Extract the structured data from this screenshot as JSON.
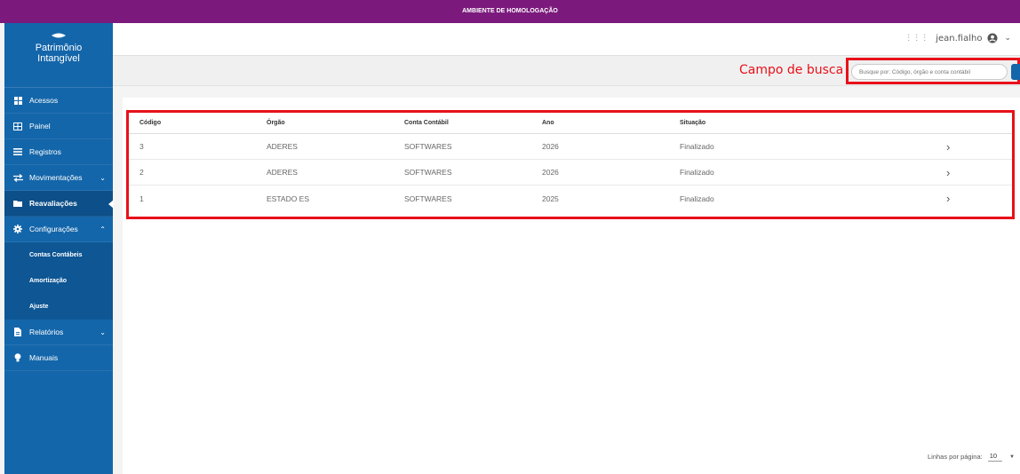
{
  "env_banner": "AMBIENTE DE HOMOLOGAÇÃO",
  "colors": {
    "env": "#7b1a7c",
    "sidebar": "#1466aa",
    "highlight": "#e8101a"
  },
  "logo": {
    "line1": "Patrimônio",
    "line2": "Intangível"
  },
  "sidebar": {
    "items": [
      {
        "label": "Acessos",
        "icon": "grid-icon"
      },
      {
        "label": "Painel",
        "icon": "dashboard-icon"
      },
      {
        "label": "Registros",
        "icon": "list-icon"
      },
      {
        "label": "Movimentações",
        "icon": "swap-icon"
      },
      {
        "label": "Reavaliações",
        "icon": "folder-icon"
      },
      {
        "label": "Configurações",
        "icon": "gear-icon"
      }
    ],
    "subitems": [
      {
        "label": "Contas Contábeis"
      },
      {
        "label": "Amortização"
      },
      {
        "label": "Ajuste"
      }
    ],
    "bottom_items": [
      {
        "label": "Relatórios",
        "icon": "report-icon"
      },
      {
        "label": "Manuais",
        "icon": "bulb-icon"
      }
    ]
  },
  "header": {
    "username": "jean.fialho"
  },
  "search": {
    "label": "Campo de busca",
    "placeholder": "Busque por: Código, órgão e conta contábil"
  },
  "table": {
    "headers": [
      "Código",
      "Órgão",
      "Conta Contábil",
      "Ano",
      "Situação"
    ],
    "rows": [
      {
        "codigo": "3",
        "orgao": "ADERES",
        "conta": "SOFTWARES",
        "ano": "2026",
        "situacao": "Finalizado"
      },
      {
        "codigo": "2",
        "orgao": "ADERES",
        "conta": "SOFTWARES",
        "ano": "2026",
        "situacao": "Finalizado"
      },
      {
        "codigo": "1",
        "orgao": "ESTADO ES",
        "conta": "SOFTWARES",
        "ano": "2025",
        "situacao": "Finalizado"
      }
    ]
  },
  "pagination": {
    "label": "Linhas por página:",
    "value": "10"
  }
}
